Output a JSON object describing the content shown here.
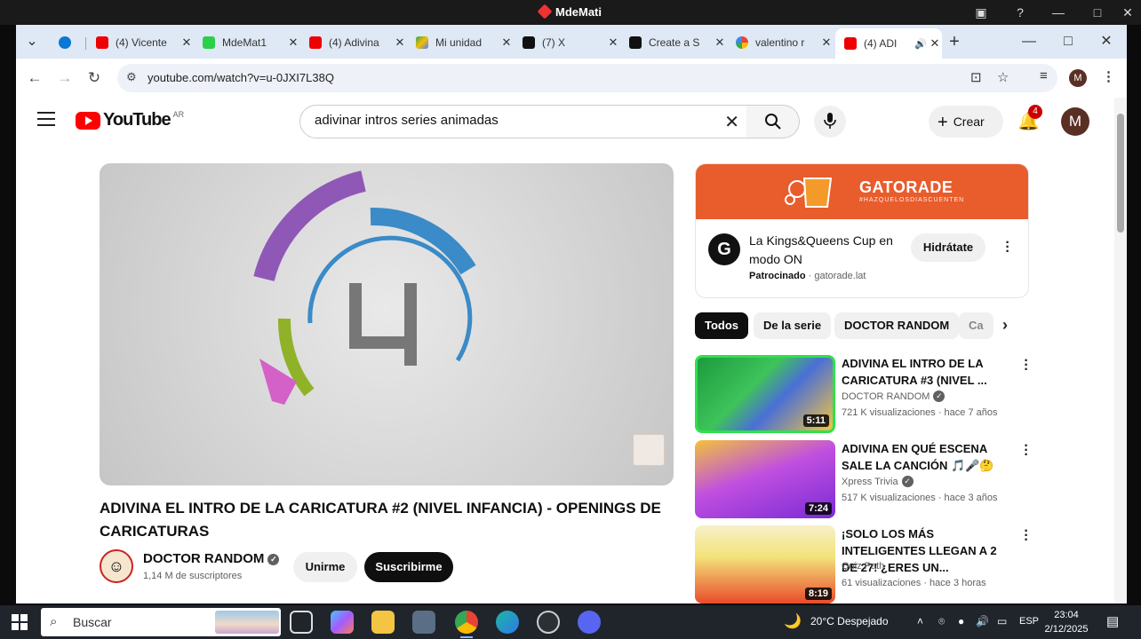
{
  "window": {
    "title": "MdeMati"
  },
  "tabs": [
    {
      "label": "(4) Vicente",
      "color": "#e00"
    },
    {
      "label": "MdeMat1",
      "color": "#2bd04a"
    },
    {
      "label": "(4) Adivina",
      "color": "#e00"
    },
    {
      "label": "Mi unidad",
      "color": "#34a853"
    },
    {
      "label": "(7) X",
      "color": "#111"
    },
    {
      "label": "Create a S",
      "color": "#111"
    },
    {
      "label": "valentino r",
      "color": "#4285f4"
    },
    {
      "label": "(4) ADI",
      "color": "#e00"
    }
  ],
  "address": {
    "url": "youtube.com/watch?v=u-0JXI7L38Q"
  },
  "youtube": {
    "logo_text": "YouTube",
    "country": "AR",
    "search_query": "adivinar intros series animadas",
    "create_label": "Crear",
    "notifications": "4",
    "avatar_letter": "M"
  },
  "video": {
    "title": "ADIVINA EL INTRO DE LA CARICATURA #2 (NIVEL INFANCIA) - OPENINGS DE CARICATURAS",
    "channel": "DOCTOR RANDOM",
    "subscribers": "1,14 M de suscriptores",
    "join_label": "Unirme",
    "subscribe_label": "Suscribirme"
  },
  "ad": {
    "brand": "GATORADE",
    "tagline": "#HAZQUELOSDIASCUENTEN",
    "text": "La Kings&Queens Cup en modo ON",
    "sponsored": "Patrocinado",
    "domain": "gatorade.lat",
    "cta": "Hidrátate"
  },
  "chips": [
    "Todos",
    "De la serie",
    "DOCTOR RANDOM",
    "Ca"
  ],
  "recommendations": [
    {
      "title": "ADIVINA EL INTRO DE LA CARICATURA #3 (NIVEL ...",
      "channel": "DOCTOR RANDOM",
      "meta": "721 K visualizaciones · hace 7 años",
      "duration": "5:11"
    },
    {
      "title": "ADIVINA EN QUÉ ESCENA SALE LA CANCIÓN 🎵🎤🤔",
      "channel": "Xpress Trivia",
      "meta": "517 K visualizaciones · hace 3 años",
      "duration": "7:24"
    },
    {
      "title": "¡SOLO LOS MÁS INTELIGENTES LLEGAN A 2 DE 27! ¿ERES UN...",
      "channel": "Quiz Path",
      "meta": "61 visualizaciones · hace 3 horas",
      "duration": "8:19"
    }
  ],
  "taskbar": {
    "search_label": "Buscar",
    "weather": "20°C  Despejado",
    "lang": "ESP",
    "time": "23:04",
    "date": "2/12/2025"
  }
}
